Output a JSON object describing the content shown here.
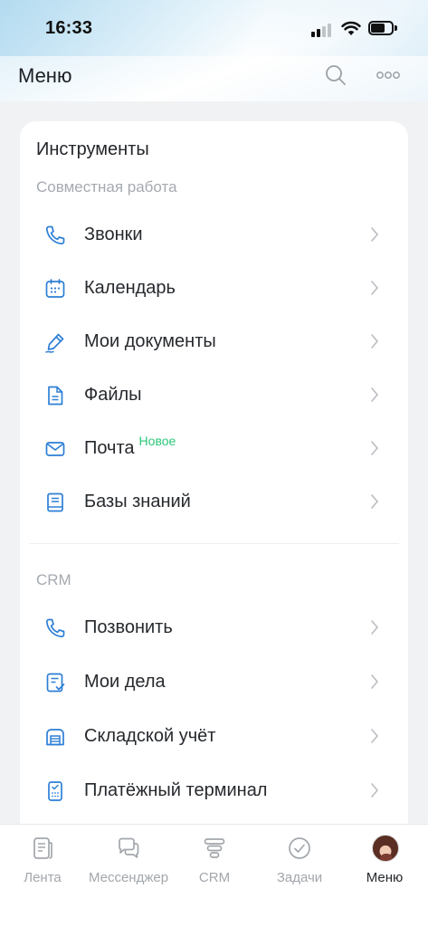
{
  "status_bar": {
    "time": "16:33"
  },
  "header": {
    "title": "Меню",
    "search_icon": "search-icon",
    "more_icon": "more-dots-icon"
  },
  "colors": {
    "accent": "#2d7fd6",
    "badge": "#2bc77a",
    "muted": "#a5aab0"
  },
  "tools": {
    "title": "Инструменты",
    "subtitle": "Совместная работа",
    "items": [
      {
        "label": "Звонки",
        "icon": "phone-icon"
      },
      {
        "label": "Календарь",
        "icon": "calendar-icon"
      },
      {
        "label": "Мои документы",
        "icon": "pen-icon"
      },
      {
        "label": "Файлы",
        "icon": "file-icon"
      },
      {
        "label": "Почта",
        "icon": "mail-icon",
        "badge": "Новое"
      },
      {
        "label": "Базы знаний",
        "icon": "book-icon"
      }
    ]
  },
  "crm": {
    "subtitle": "CRM",
    "items": [
      {
        "label": "Позвонить",
        "icon": "phone-icon"
      },
      {
        "label": "Мои дела",
        "icon": "tasks-list-icon"
      },
      {
        "label": "Складской учёт",
        "icon": "warehouse-icon"
      },
      {
        "label": "Платёжный терминал",
        "icon": "payment-terminal-icon"
      }
    ]
  },
  "tabbar": {
    "items": [
      {
        "label": "Лента",
        "icon": "feed-icon",
        "active": false
      },
      {
        "label": "Мессенджер",
        "icon": "messenger-icon",
        "active": false
      },
      {
        "label": "CRM",
        "icon": "crm-icon",
        "active": false
      },
      {
        "label": "Задачи",
        "icon": "tasks-icon",
        "active": false
      },
      {
        "label": "Меню",
        "icon": "avatar",
        "active": true
      }
    ]
  }
}
